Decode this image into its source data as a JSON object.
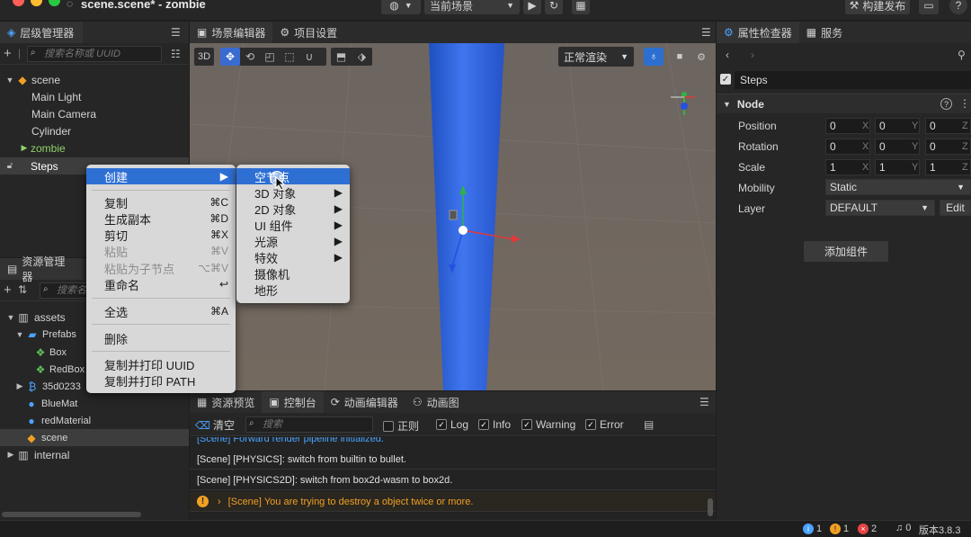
{
  "window": {
    "title": "scene.scene* - zombie"
  },
  "toolbar": {
    "current_scene": "当前场景",
    "build_label": "构建发布"
  },
  "hierarchy": {
    "tab": "层级管理器",
    "search_placeholder": "搜索名称或 UUID",
    "items": [
      "scene",
      "Main Light",
      "Main Camera",
      "Cylinder",
      "zombie",
      "Steps"
    ]
  },
  "assets": {
    "tab": "资源管理器",
    "search_placeholder": "搜索名",
    "items": [
      "assets",
      "Prefabs",
      "Box",
      "RedBox",
      "35d0233",
      "BlueMat",
      "redMaterial",
      "scene",
      "internal"
    ]
  },
  "scene_editor": {
    "tabs": [
      "场景编辑器",
      "项目设置"
    ],
    "mode_3d": "3D",
    "render_mode": "正常渲染"
  },
  "context_menu": {
    "items": [
      {
        "label": "创建",
        "shortcut": ""
      },
      {
        "label": "复制",
        "shortcut": "⌘C"
      },
      {
        "label": "生成副本",
        "shortcut": "⌘D"
      },
      {
        "label": "剪切",
        "shortcut": "⌘X"
      },
      {
        "label": "粘贴",
        "shortcut": "⌘V"
      },
      {
        "label": "粘贴为子节点",
        "shortcut": "⌥⌘V"
      },
      {
        "label": "重命名",
        "shortcut": "↩"
      },
      {
        "label": "全选",
        "shortcut": "⌘A"
      },
      {
        "label": "删除",
        "shortcut": ""
      },
      {
        "label": "复制并打印 UUID",
        "shortcut": ""
      },
      {
        "label": "复制并打印 PATH",
        "shortcut": ""
      }
    ],
    "submenu": [
      "空节点",
      "3D 对象",
      "2D 对象",
      "UI 组件",
      "光源",
      "特效",
      "摄像机",
      "地形"
    ]
  },
  "bottom_panel": {
    "tabs": [
      "资源预览",
      "控制台",
      "动画编辑器",
      "动画图"
    ],
    "clear": "清空",
    "search_placeholder": "搜索",
    "filters": [
      {
        "label": "正则",
        "checked": false
      },
      {
        "label": "Log",
        "checked": true
      },
      {
        "label": "Info",
        "checked": true
      },
      {
        "label": "Warning",
        "checked": true
      },
      {
        "label": "Error",
        "checked": true
      }
    ],
    "logs": [
      "[Scene] Forward render pipeline initialized.",
      "[Scene] [PHYSICS]: switch from builtin to bullet.",
      "[Scene] [PHYSICS2D]: switch from box2d-wasm to box2d.",
      "[Scene] You are trying to destroy a object twice or more."
    ]
  },
  "inspector": {
    "tabs": [
      "属性检查器",
      "服务"
    ],
    "node_name": "Steps",
    "section": "Node",
    "position": {
      "label": "Position",
      "x": "0",
      "y": "0",
      "z": "0"
    },
    "rotation": {
      "label": "Rotation",
      "x": "0",
      "y": "0",
      "z": "0"
    },
    "scale": {
      "label": "Scale",
      "x": "1",
      "y": "1",
      "z": "1"
    },
    "mobility": {
      "label": "Mobility",
      "value": "Static"
    },
    "layer": {
      "label": "Layer",
      "value": "DEFAULT",
      "edit": "Edit"
    },
    "add_component": "添加组件",
    "axis_labels": [
      "X",
      "Y",
      "Z"
    ]
  },
  "status": {
    "info": "1",
    "warn": "1",
    "error": "2",
    "notify": "0",
    "version": "版本3.8.3"
  },
  "colors": {
    "accent": "#2e6fd4",
    "cylinder": "#2f62d8",
    "warning": "#f0a023",
    "error": "#e64545"
  }
}
